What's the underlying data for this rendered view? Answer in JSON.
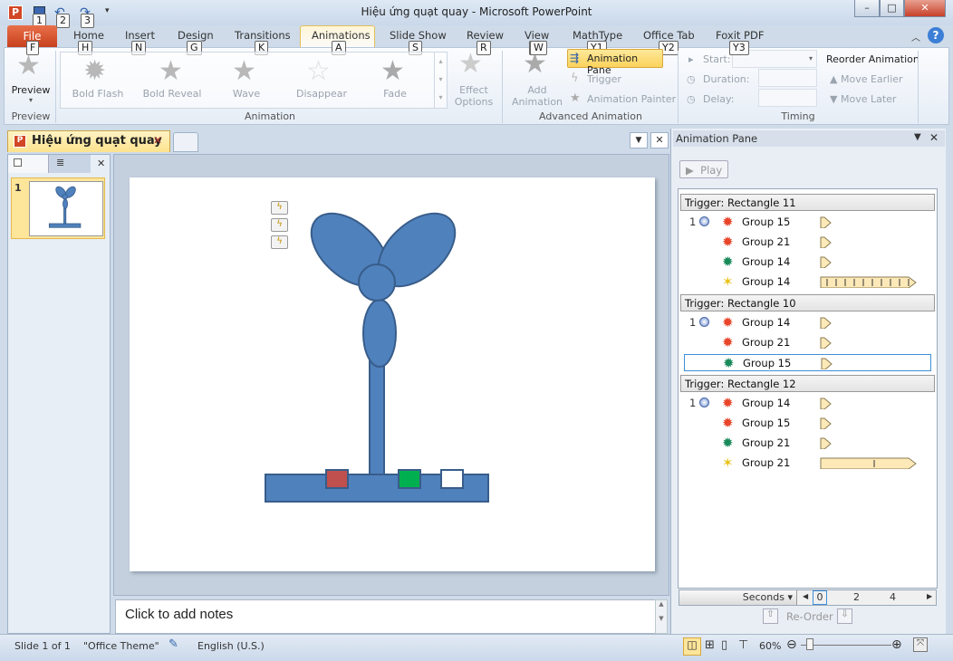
{
  "window": {
    "title": "Hiệu ứng quạt quay  -  Microsoft PowerPoint",
    "minimize": "–",
    "maximize": "□",
    "close": "✕"
  },
  "qat": {
    "keytips": [
      "1",
      "2",
      "3"
    ]
  },
  "tabs": [
    {
      "label": "File",
      "keytip": "F"
    },
    {
      "label": "Home",
      "keytip": "H"
    },
    {
      "label": "Insert",
      "keytip": "N"
    },
    {
      "label": "Design",
      "keytip": "G"
    },
    {
      "label": "Transitions",
      "keytip": "K"
    },
    {
      "label": "Animations",
      "keytip": "A"
    },
    {
      "label": "Slide Show",
      "keytip": "S"
    },
    {
      "label": "Review",
      "keytip": "R"
    },
    {
      "label": "View",
      "keytip": "W"
    },
    {
      "label": "MathType",
      "keytip": "Y1"
    },
    {
      "label": "Office Tab",
      "keytip": "Y2"
    },
    {
      "label": "Foxit PDF",
      "keytip": "Y3"
    }
  ],
  "ribbon": {
    "preview": {
      "label": "Preview",
      "group": "Preview"
    },
    "animation_gallery": [
      "Bold Flash",
      "Bold Reveal",
      "Wave",
      "Disappear",
      "Fade"
    ],
    "effect_options": "Effect Options",
    "animation_group": "Animation",
    "add_animation": "Add Animation",
    "animation_pane": "Animation Pane",
    "trigger": "Trigger",
    "animation_painter": "Animation Painter",
    "advanced_group": "Advanced Animation",
    "start_label": "Start:",
    "duration_label": "Duration:",
    "delay_label": "Delay:",
    "timing_group": "Timing",
    "reorder_title": "Reorder Animation",
    "move_earlier": "Move Earlier",
    "move_later": "Move Later"
  },
  "document": {
    "tab_title": "Hiệu ứng quạt quay",
    "slide_number": "1",
    "notes_placeholder": "Click to add notes"
  },
  "slide": {
    "colors": {
      "shape": "#4f81bd",
      "outline": "#385d8a",
      "red": "#c0504d",
      "green": "#00b050",
      "white": "#ffffff"
    }
  },
  "animation_pane": {
    "title": "Animation Pane",
    "play": "Play",
    "groups": [
      {
        "trigger": "Trigger: Rectangle 11",
        "items": [
          {
            "num": "1",
            "clock": true,
            "effect": "emphasis-red",
            "name": "Group 15",
            "bar": "short"
          },
          {
            "num": "",
            "effect": "emphasis-red",
            "name": "Group 21",
            "bar": "short"
          },
          {
            "num": "",
            "effect": "emphasis-green",
            "name": "Group 14",
            "bar": "short"
          },
          {
            "num": "",
            "effect": "motion-yellow",
            "name": "Group 14",
            "bar": "long-ticks"
          }
        ]
      },
      {
        "trigger": "Trigger: Rectangle 10",
        "items": [
          {
            "num": "1",
            "clock": true,
            "effect": "emphasis-red",
            "name": "Group 14",
            "bar": "short"
          },
          {
            "num": "",
            "effect": "emphasis-red",
            "name": "Group 21",
            "bar": "short"
          },
          {
            "num": "",
            "effect": "emphasis-green",
            "name": "Group 15",
            "bar": "short",
            "selected": true
          }
        ]
      },
      {
        "trigger": "Trigger: Rectangle 12",
        "items": [
          {
            "num": "1",
            "clock": true,
            "effect": "emphasis-red",
            "name": "Group 14",
            "bar": "short"
          },
          {
            "num": "",
            "effect": "emphasis-red",
            "name": "Group 15",
            "bar": "short"
          },
          {
            "num": "",
            "effect": "emphasis-green",
            "name": "Group 21",
            "bar": "short"
          },
          {
            "num": "",
            "effect": "motion-yellow",
            "name": "Group 21",
            "bar": "long-one-tick"
          }
        ]
      }
    ],
    "seconds": "Seconds",
    "timeline": [
      "0",
      "2",
      "4"
    ],
    "reorder": "Re-Order"
  },
  "status": {
    "slide": "Slide 1 of 1",
    "theme": "\"Office Theme\"",
    "language": "English (U.S.)",
    "zoom": "60%",
    "zoom_percent": 60
  }
}
